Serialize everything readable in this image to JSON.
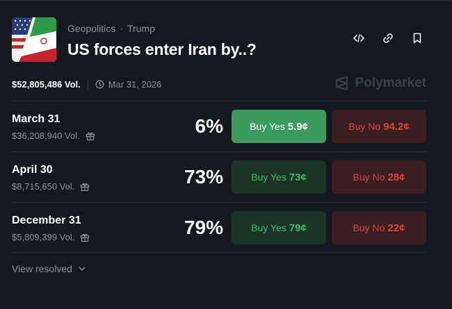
{
  "market": {
    "breadcrumb": [
      "Geopolitics",
      "Trump"
    ],
    "breadcrumb_sep": "·",
    "title": "US forces enter Iran by..?",
    "total_volume": "$52,805,486 Vol.",
    "end_date": "Mar 31, 2026",
    "brand": "Polymarket",
    "thumbnail_icon": "us-iran-flags-image"
  },
  "outcomes": [
    {
      "label": "March 31",
      "volume": "$36,208,940 Vol.",
      "percent": "6%",
      "yes_label": "Buy Yes",
      "yes_price": "5.9¢",
      "no_label": "Buy No",
      "no_price": "94.2¢",
      "yes_active": true
    },
    {
      "label": "April 30",
      "volume": "$8,715,650 Vol.",
      "percent": "73%",
      "yes_label": "Buy Yes",
      "yes_price": "73¢",
      "no_label": "Buy No",
      "no_price": "28¢",
      "yes_active": false
    },
    {
      "label": "December 31",
      "volume": "$5,809,399 Vol.",
      "percent": "79%",
      "yes_label": "Buy Yes",
      "yes_price": "79¢",
      "no_label": "Buy No",
      "no_price": "22¢",
      "yes_active": false
    }
  ],
  "footer": {
    "view_resolved": "View resolved"
  },
  "colors": {
    "background": "#15191f",
    "yes": "#3dba6b",
    "yes_active_bg": "#3a9b5c",
    "no": "#d9443b"
  }
}
